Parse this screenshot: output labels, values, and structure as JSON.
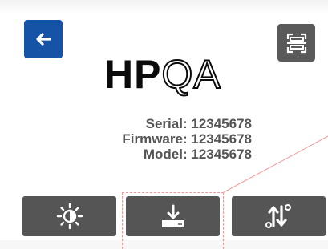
{
  "header": {
    "back_icon": "arrow-left-icon",
    "scan_icon": "scan-frame-icon"
  },
  "logo": {
    "solid": "HP",
    "outline": "QA"
  },
  "device_info": {
    "serial_label": "Serial:",
    "serial_value": "12345678",
    "firmware_label": "Firmware:",
    "firmware_value": "12345678",
    "model_label": "Model:",
    "model_value": "12345678"
  },
  "actions": [
    {
      "icon": "brightness-icon"
    },
    {
      "icon": "download-icon"
    },
    {
      "icon": "sort-settings-icon"
    }
  ],
  "colors": {
    "back_button": "#1553a6",
    "dark_button": "#555555",
    "info_text": "#555555",
    "annotation": "#f19c9c"
  }
}
